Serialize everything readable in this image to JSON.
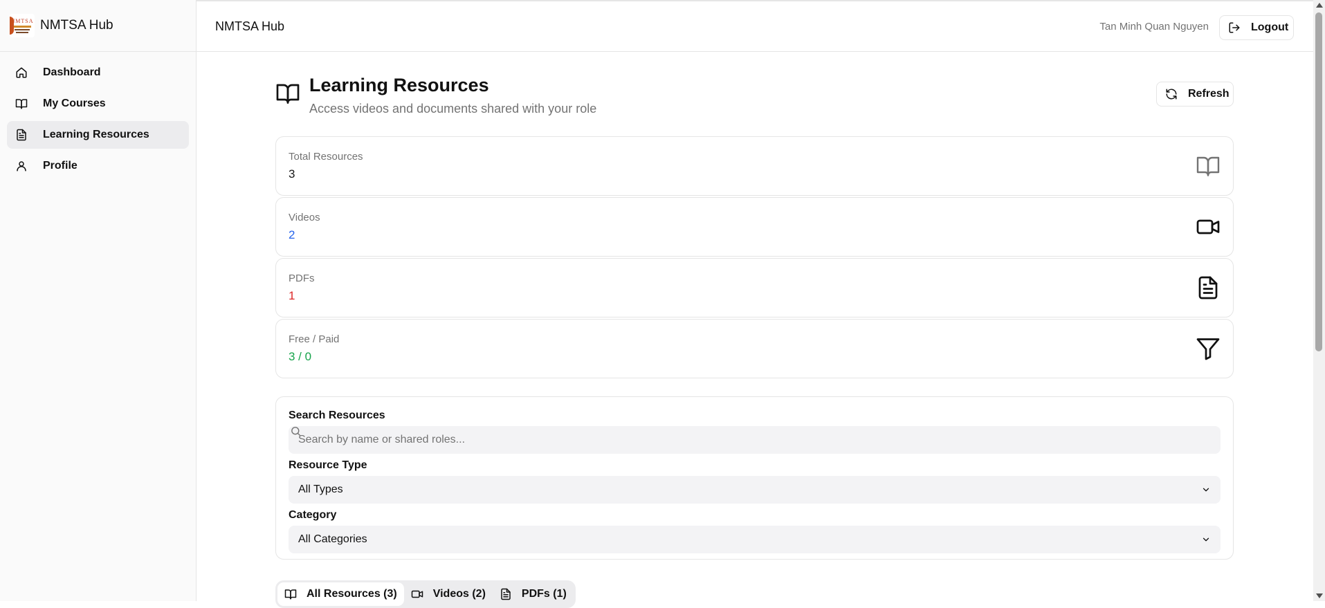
{
  "brand": {
    "name": "NMTSA Hub",
    "logo_text": "NMTSA"
  },
  "sidebar": {
    "items": [
      {
        "label": "Dashboard",
        "icon": "home-icon"
      },
      {
        "label": "My Courses",
        "icon": "book-open-icon"
      },
      {
        "label": "Learning Resources",
        "icon": "file-text-icon",
        "active": true
      },
      {
        "label": "Profile",
        "icon": "user-icon"
      }
    ]
  },
  "topbar": {
    "title": "NMTSA Hub",
    "user_name": "Tan Minh Quan Nguyen",
    "logout_label": "Logout"
  },
  "page": {
    "title": "Learning Resources",
    "subtitle": "Access videos and documents shared with your role",
    "refresh_label": "Refresh"
  },
  "stats": [
    {
      "label": "Total Resources",
      "value": "3",
      "color": "#171717",
      "icon": "book-open-icon"
    },
    {
      "label": "Videos",
      "value": "2",
      "color": "#2563eb",
      "icon": "video-icon"
    },
    {
      "label": "PDFs",
      "value": "1",
      "color": "#dc2626",
      "icon": "file-text-icon"
    },
    {
      "label": "Free / Paid",
      "value": "3 / 0",
      "color": "#16a34a",
      "icon": "filter-icon"
    }
  ],
  "filters": {
    "search_label": "Search Resources",
    "search_placeholder": "Search by name or shared roles...",
    "type_label": "Resource Type",
    "type_value": "All Types",
    "category_label": "Category",
    "category_value": "All Categories"
  },
  "tabs": [
    {
      "label": "All Resources (3)",
      "icon": "book-open-icon",
      "active": true
    },
    {
      "label": "Videos (2)",
      "icon": "video-icon"
    },
    {
      "label": "PDFs (1)",
      "icon": "file-text-icon"
    }
  ],
  "colors": {
    "accent_blue": "#2563eb",
    "accent_red": "#dc2626",
    "accent_green": "#16a34a",
    "muted": "#737373"
  }
}
